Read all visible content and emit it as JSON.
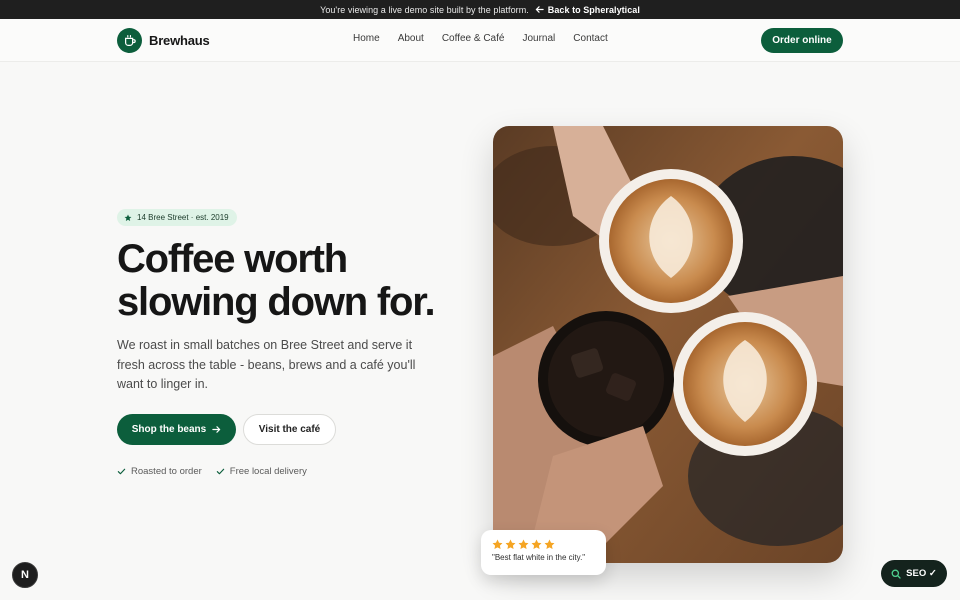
{
  "demo_bar": {
    "message": "You're viewing a live demo site built by the platform.",
    "back_label": "Back to Spheralytical"
  },
  "header": {
    "brand_name": "Brewhaus",
    "nav": [
      "Home",
      "About",
      "Coffee & Café",
      "Journal",
      "Contact"
    ],
    "order_label": "Order online"
  },
  "hero": {
    "badge": "14 Bree Street · est. 2019",
    "headline_line1": "Coffee worth",
    "headline_line2": "slowing down for.",
    "lede": "We roast in small batches on Bree Street and serve it fresh across the table - beans, brews and a café you'll want to linger in.",
    "cta_primary": "Shop the beans",
    "cta_secondary": "Visit the café",
    "features": [
      "Roasted to order",
      "Free local delivery"
    ]
  },
  "review": {
    "rating": 5,
    "text": "\"Best flat white in the city.\""
  },
  "widgets": {
    "next_badge": "N",
    "seo_label": "SEO ✓"
  },
  "colors": {
    "brand_green": "#0c5e3c",
    "badge_bg": "#dff3e7",
    "star": "#f5a524",
    "dark_bar": "#1f1f1f"
  },
  "icons": {
    "brand": "coffee-cup-icon",
    "back": "arrow-left-icon",
    "badge": "star-icon",
    "cta": "arrow-right-icon",
    "feature": "check-icon",
    "seo": "search-icon"
  }
}
